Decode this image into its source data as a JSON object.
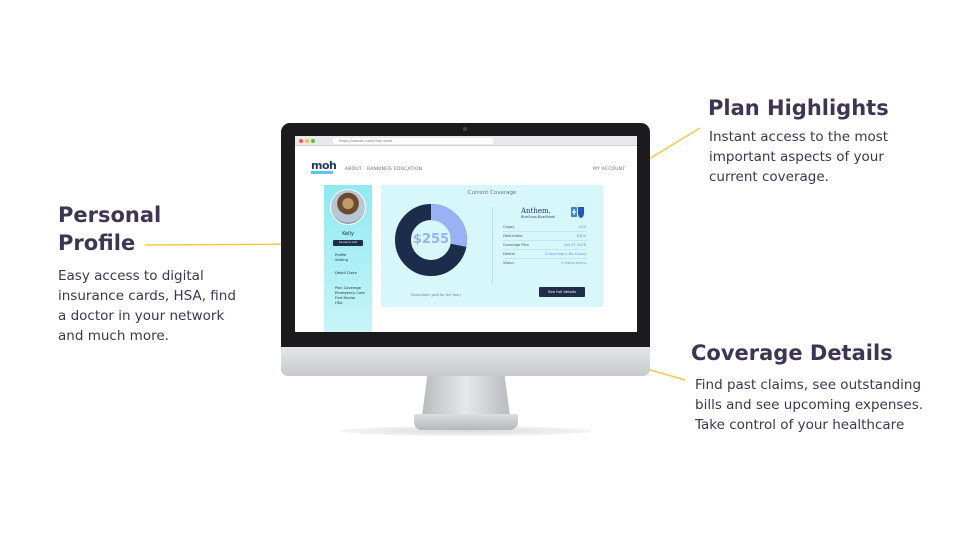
{
  "callouts": {
    "plan": {
      "title": "Plan Highlights",
      "lines": [
        "Instant access to the most",
        "important aspects of your",
        "current coverage."
      ]
    },
    "profile": {
      "title_lines": [
        "Personal",
        "Profile"
      ],
      "lines": [
        "Easy access to digital",
        "insurance cards, HSA, find",
        "a doctor in your network",
        "and much more."
      ]
    },
    "coverage": {
      "title": "Coverage Details",
      "lines": [
        "Find past claims, see outstanding",
        "bills and see upcoming expenses.",
        "Take control of your healthcare"
      ]
    }
  },
  "screen": {
    "browser": {
      "url": "https://domain.com/ting-name"
    },
    "logo": "moh",
    "nav": {
      "about": "ABOUT",
      "rankings": "RANKINGS",
      "education": "EDUCATION",
      "account": "MY ACCOUNT"
    },
    "sidebar": {
      "name": "Kelly",
      "button": "Insurance card",
      "items": [
        "Profile",
        "Setting",
        "Detail Claim",
        "Plan Coverage",
        "Emergency Care",
        "Find Doctor",
        "HSA"
      ]
    },
    "coverage": {
      "title": "Current Coverage",
      "donut_value": "$255",
      "donut_fraction": 0.28,
      "donut_caption": "Deductible (paid for the Year)",
      "insurer": {
        "name": "Anthem.",
        "sub": "BlueCross BlueShield"
      },
      "rows": [
        {
          "label": "Copay",
          "value": "$25"
        },
        {
          "label": "Deductible",
          "value": "$300"
        },
        {
          "label": "Coverage Plan",
          "value": "Jan 07 2018"
        },
        {
          "label": "Dental",
          "value": "2 cleanings | No Copay"
        },
        {
          "label": "Vision",
          "value": "2 vision exam"
        }
      ],
      "details_button": "See full details"
    }
  },
  "colors": {
    "accent_yellow": "#f6c945",
    "navy": "#1e2d4a",
    "donut_light": "#9bb0f5",
    "donut_dark": "#1b2d4b",
    "panel_bg": "#d7f7fa",
    "sidebar_bg": "#8eeaf2"
  }
}
